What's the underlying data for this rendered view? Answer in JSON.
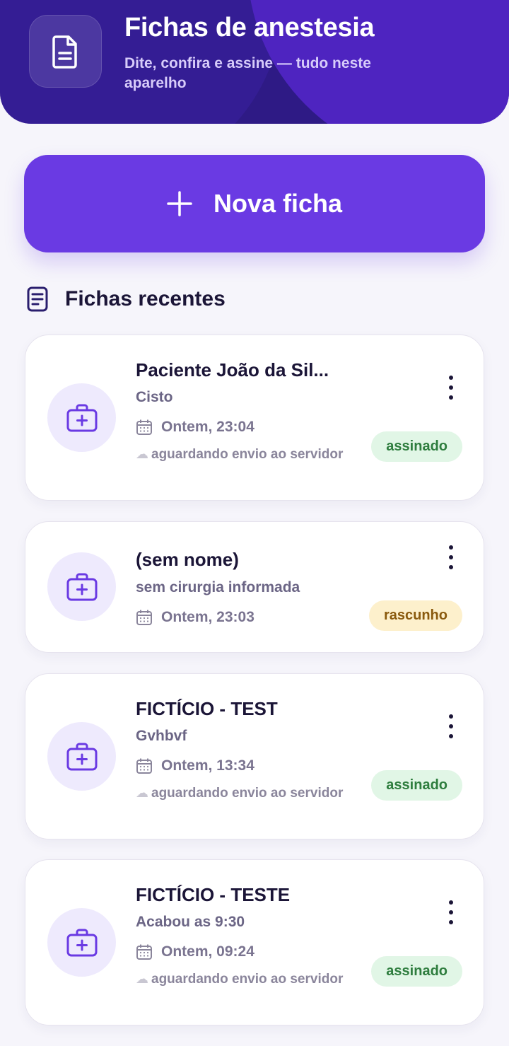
{
  "header": {
    "title": "Fichas de anestesia",
    "subtitle": "Dite, confira e assine — tudo neste aparelho"
  },
  "new_button": {
    "label": "Nova ficha"
  },
  "recent": {
    "title": "Fichas recentes",
    "cards": [
      {
        "name": "Paciente João da Sil...",
        "surgery": "Cisto",
        "date": "Ontem, 23:04",
        "sync": "aguardando envio ao servidor",
        "status": "assinado"
      },
      {
        "name": "(sem nome)",
        "surgery": "sem cirurgia informada",
        "date": "Ontem, 23:03",
        "sync": "",
        "status": "rascunho"
      },
      {
        "name": "FICTÍCIO - TEST",
        "surgery": "Gvhbvf",
        "date": "Ontem, 13:34",
        "sync": "aguardando envio ao servidor",
        "status": "assinado"
      },
      {
        "name": "FICTÍCIO - TESTE",
        "surgery": "Acabou as 9:30",
        "date": "Ontem, 09:24",
        "sync": "aguardando envio ao servidor",
        "status": "assinado"
      }
    ]
  },
  "colors": {
    "header_bg": "#2E1A85",
    "primary": "#6A3AE3",
    "badge_signed_bg": "#E1F6E6",
    "badge_signed_text": "#2E7D3E",
    "badge_draft_bg": "#FDF0CC",
    "badge_draft_text": "#8A5A0E"
  },
  "icons": {
    "header": "document-icon",
    "new_button": "plus-icon",
    "section": "list-document-icon",
    "card_avatar": "medical-case-icon",
    "card_date": "calendar-icon",
    "card_sync": "cloud-icon",
    "card_menu": "more-vertical-icon"
  }
}
